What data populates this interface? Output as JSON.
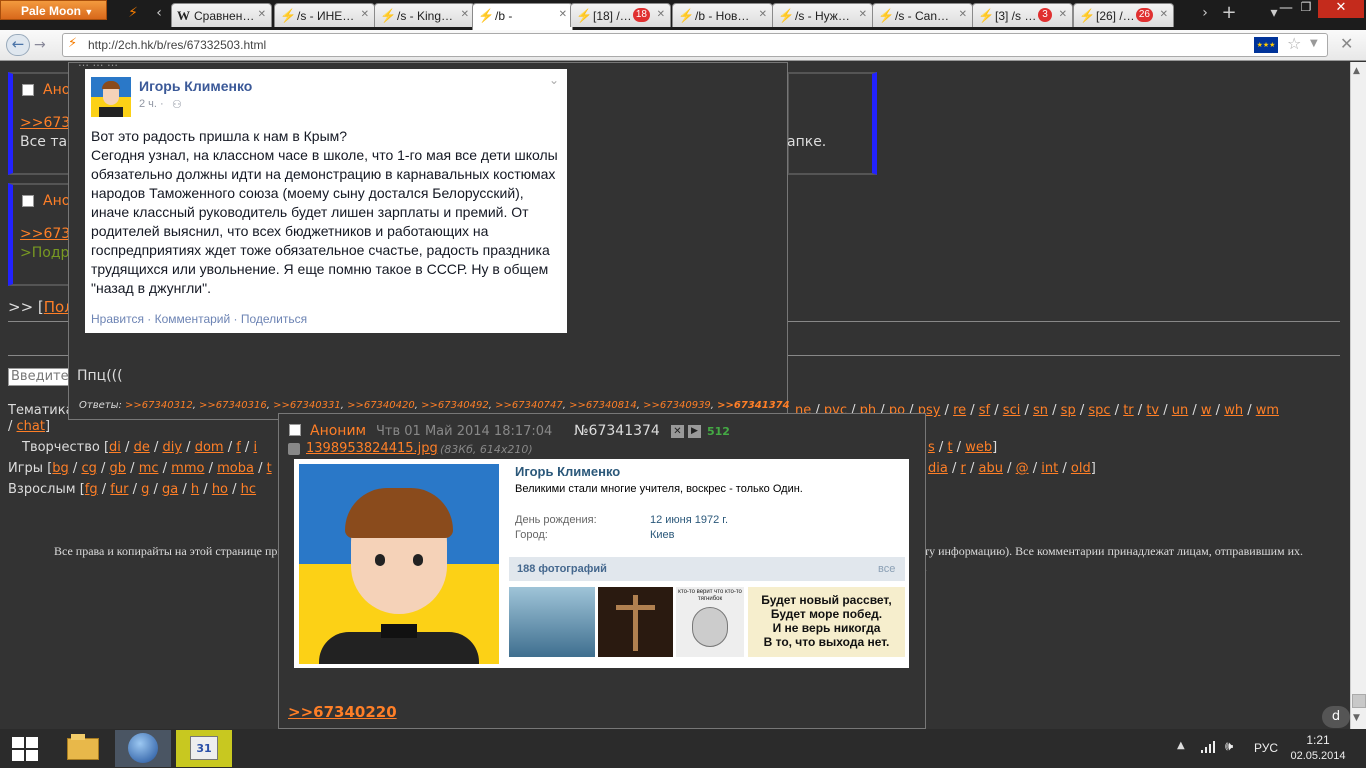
{
  "browser": {
    "menu_label": "Pale Moon",
    "url": "http://2ch.hk/b/res/67332503.html",
    "tabs": [
      {
        "label": "Сравнен…"
      },
      {
        "label": "/s - ИНЕ…"
      },
      {
        "label": "/s - King…"
      },
      {
        "label": "/b -"
      },
      {
        "label": "[18] /…",
        "badge": "18"
      },
      {
        "label": "/b - Нов…"
      },
      {
        "label": "/s - Нуж…"
      },
      {
        "label": "/s - Can…"
      },
      {
        "label": "[3] /s …",
        "badge": "3"
      },
      {
        "label": "[26] /…",
        "badge": "26"
      }
    ]
  },
  "page": {
    "posts": [
      {
        "name": "Ано",
        "reply": ">>673",
        "text": "Все та",
        "text_right": "апке."
      },
      {
        "name": "Ано",
        "reply": ">>673",
        "quote": ">Подр"
      }
    ],
    "reply_prefix": ">> [",
    "reply_link": "Пол",
    "search_placeholder": "Введите",
    "boards": {
      "themes_label": "Тематика",
      "themes_right": [
        "ne",
        "pvc",
        "ph",
        "po",
        "psy",
        "re",
        "sf",
        "sci",
        "sn",
        "sp",
        "spc",
        "tr",
        "tv",
        "un",
        "w",
        "wh",
        "wm"
      ],
      "chat_line": [
        "chat"
      ],
      "creative_label": "Творчество [",
      "creative_left": [
        "di",
        "de",
        "diy",
        "dom",
        "f",
        "i"
      ],
      "creative_right": [
        "s",
        "t",
        "web"
      ],
      "games_label": "Игры [",
      "games_left": [
        "bg",
        "cg",
        "gb",
        "mc",
        "mmo",
        "moba",
        "t"
      ],
      "games_right": [
        "dia",
        "r",
        "abu",
        "@",
        "int",
        "old"
      ],
      "adult_label": "Взрослым [",
      "adult_left": [
        "fg",
        "fur",
        "g",
        "ga",
        "h",
        "ho",
        "hc"
      ]
    },
    "copyright_left": "Все права и копирайты на этой странице при",
    "copyright_right": "ту информацию). Все комментарии принадлежат лицам, отправившим их."
  },
  "popup1": {
    "top_text": "… … …",
    "fb": {
      "author": "Игорь Клименко",
      "time": "2 ч. ·",
      "text": "Вот это радость пришла к нам в Крым?\nСегодня узнал, на классном часе в школе, что 1-го мая все дети школы обязательно должны идти на демонстрацию в карнавальных костюмах народов Таможенного союза (моему сыну достался Белорусский), иначе классный руководитель будет лишен зарплаты и премий. От родителей выяснил, что всех бюджетников и работающих на госпредприятиях ждет тоже обязательное счастье, радость праздника трудящихся или увольнение. Я еще помню такое в СССР. Ну в общем \"назад в джунгли\".",
      "actions": "Нравится · Комментарий · Поделиться"
    },
    "comment": "Ппц(((",
    "replies_label": "Ответы:",
    "replies": [
      ">>67340312",
      ">>67340316",
      ">>67340331",
      ">>67340420",
      ">>67340492",
      ">>67340747",
      ">>67340814",
      ">>67340939",
      ">>67341374"
    ]
  },
  "popup2": {
    "name": "Аноним",
    "date": "Чтв 01 Май 2014 18:17:04",
    "post_no": "№67341374",
    "score": "512",
    "file": "1398953824415.jpg",
    "file_meta": "(83Кб, 614x210)",
    "vk": {
      "name": "Игорь Клименко",
      "status": "Великими стали многие учителя, воскрес - только Один.",
      "birthday_label": "День рождения:",
      "birthday": "12 июня 1972 г.",
      "city_label": "Город:",
      "city": "Киев",
      "photos": "188 фотографий",
      "all": "все",
      "meme_top": "ктo-то верит чтo ктo-то тягнибок",
      "poster": "Будет новый рассвет,\nБудет море побед.\nИ не верь никогда\nВ то, что выхода нет."
    },
    "reply_link": ">>67340220"
  },
  "taskbar": {
    "lang": "РУС",
    "time": "1:21",
    "date": "02.05.2014"
  }
}
